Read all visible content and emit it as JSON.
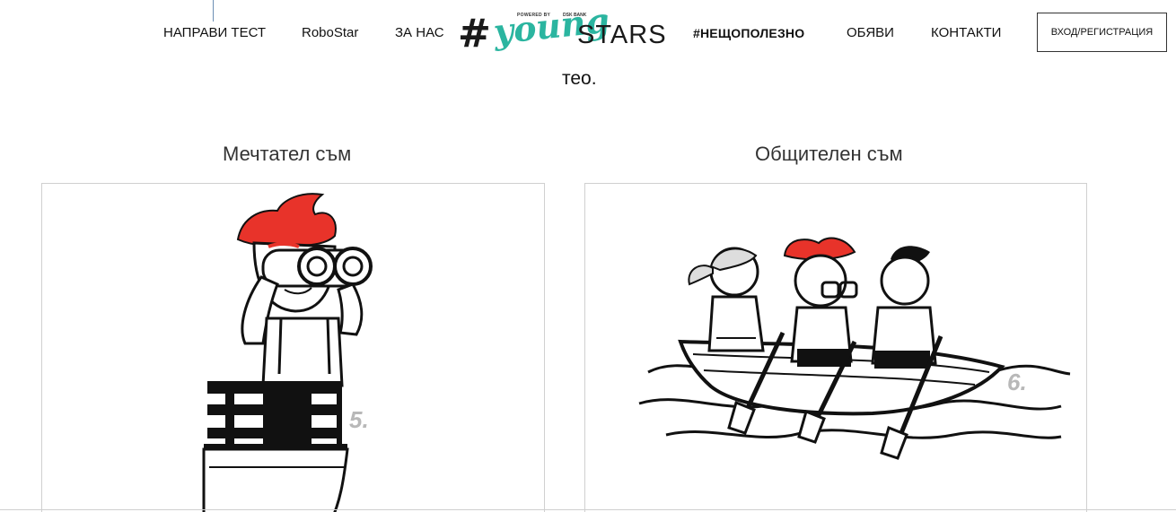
{
  "nav": {
    "take_test": "НАПРАВИ ТЕСТ",
    "robostar": "RoboStar",
    "about": "ЗА НАС",
    "useful": "#НЕЩОПОЛЕЗНО",
    "ads": "ОБЯВИ",
    "contacts": "КОНТАКТИ",
    "login": "ВХОД/РЕГИСТРАЦИЯ"
  },
  "logo": {
    "hash": "#",
    "young": "young",
    "stars": "STARS",
    "powered_by": "POWERED BY",
    "bank": "DSK BANK"
  },
  "intro_text": "тео.",
  "cards": [
    {
      "title": "Мечтател съм",
      "number": "5."
    },
    {
      "title": "Общителен съм",
      "number": "6."
    }
  ],
  "colors": {
    "accent_red": "#e8332a",
    "brand_teal": "#2bb5a0",
    "number_gray": "#b8b8b8"
  }
}
